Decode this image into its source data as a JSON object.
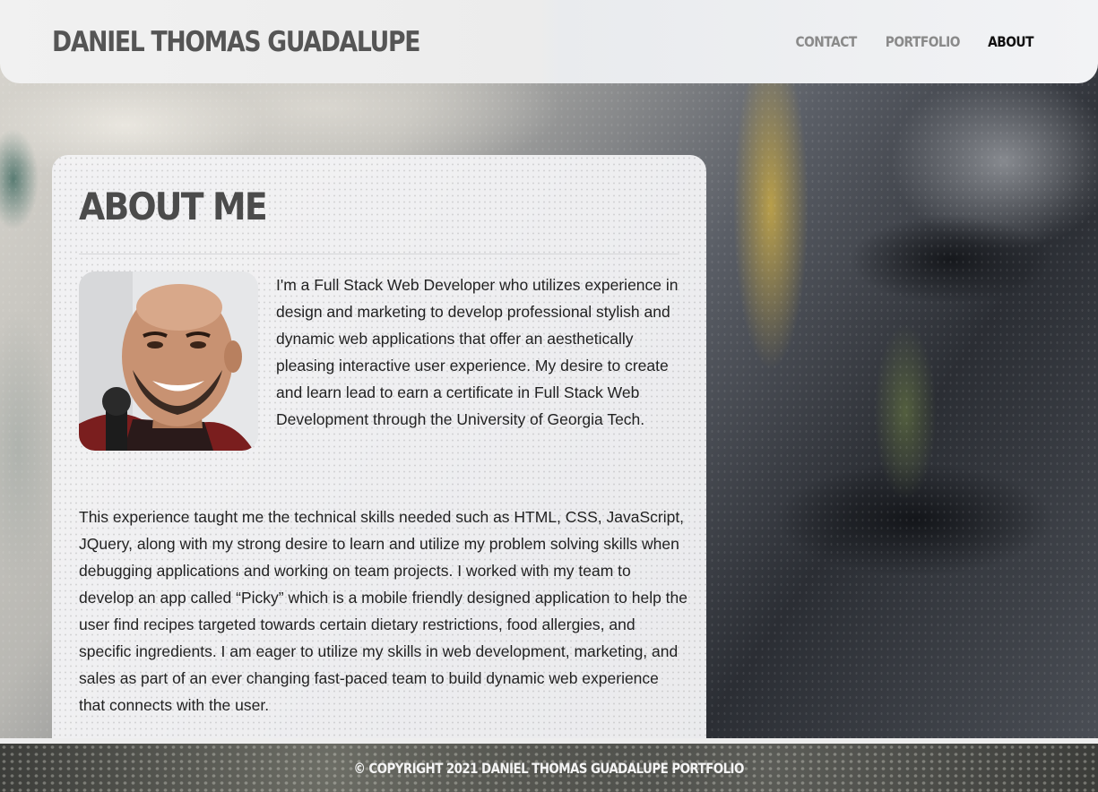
{
  "header": {
    "brand": "DANIEL THOMAS GUADALUPE",
    "nav": [
      {
        "label": "CONTACT",
        "active": false
      },
      {
        "label": "PORTFOLIO",
        "active": false
      },
      {
        "label": "ABOUT",
        "active": true
      }
    ]
  },
  "about": {
    "heading": "ABOUT ME",
    "paragraph_1": "I'm a Full Stack Web Developer who utilizes experience in design and marketing to develop professional stylish and dynamic web applications that offer an aesthetically pleasing interactive user experience. My desire to create and learn lead to earn a certificate in Full Stack Web Development through the University of Georgia Tech.",
    "paragraph_2": "This experience taught me the technical skills needed such as HTML, CSS, JavaScript, JQuery, along with my strong desire to learn and utilize my problem solving skills when debugging applications and working on team projects. I worked with my team to develop an app called “Picky” which is a mobile friendly designed application to help the user find recipes targeted towards certain dietary restrictions, food allergies, and specific ingredients. I am eager to utilize my skills in web development, marketing, and sales as part of an ever changing fast-paced team to build dynamic web experience that connects with the user."
  },
  "footer": {
    "copyright": "© COPYRIGHT 2021 DANIEL THOMAS GUADALUPE PORTFOLIO"
  },
  "colors": {
    "nav_active": "#111111",
    "nav_inactive": "#8a8a8a",
    "brand": "#555555",
    "heading": "#4b4b4b"
  }
}
